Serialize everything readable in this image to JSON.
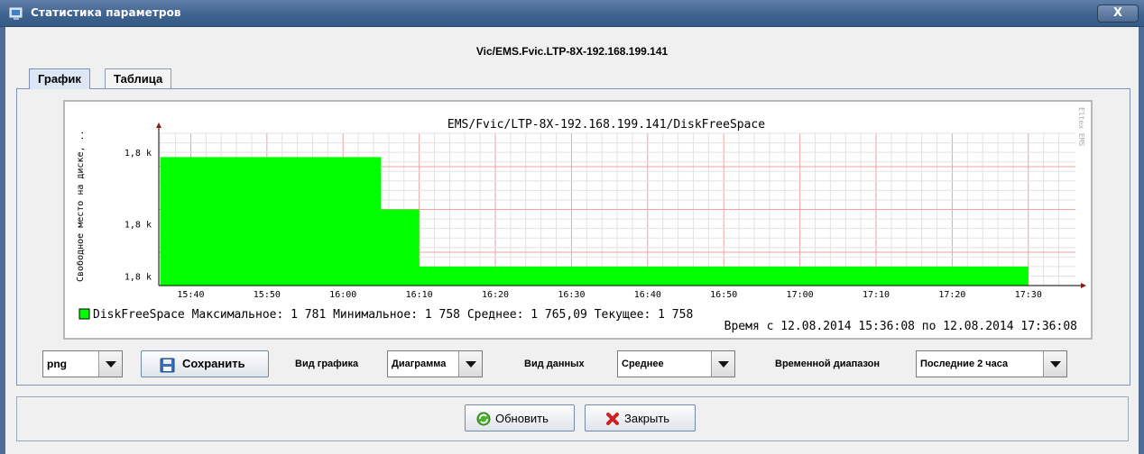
{
  "window": {
    "title": "Статистика параметров",
    "close_label": "X"
  },
  "device_name": "Vic/EMS.Fvic.LTP-8X-192.168.199.141",
  "tabs": [
    {
      "label": "График",
      "active": true
    },
    {
      "label": "Таблица",
      "active": false
    }
  ],
  "chart_data": {
    "type": "area",
    "title": "EMS/Fvic/LTP-8X-192.168.199.141/DiskFreeSpace",
    "ylabel": "Свободное место на диске, ..",
    "watermark": "Eltex EMS",
    "x_ticks": [
      "15:40",
      "15:50",
      "16:00",
      "16:10",
      "16:20",
      "16:30",
      "16:40",
      "16:50",
      "17:00",
      "17:10",
      "17:20",
      "17:30"
    ],
    "y_ticks": [
      "1,8 k",
      "1,8 k",
      "1,8 k"
    ],
    "series": [
      {
        "name": "DiskFreeSpace",
        "color": "#00ff00",
        "points": [
          {
            "x": "15:36",
            "y": 1781
          },
          {
            "x": "16:05",
            "y": 1781
          },
          {
            "x": "16:05",
            "y": 1770
          },
          {
            "x": "16:10",
            "y": 1770
          },
          {
            "x": "16:10",
            "y": 1758
          },
          {
            "x": "17:30",
            "y": 1758
          }
        ]
      }
    ],
    "legend": {
      "name": "DiskFreeSpace",
      "max": "Максимальное: 1 781",
      "min": "Минимальное: 1 758",
      "avg": "Среднее: 1 765,09",
      "cur": "Текущее: 1 758"
    },
    "time_range_text": "Время с 12.08.2014 15:36:08 по 12.08.2014 17:36:08"
  },
  "controls": {
    "format_value": "png",
    "save_label": "Сохранить",
    "chart_type_label": "Вид графика",
    "chart_type_value": "Диаграмма",
    "data_type_label": "Вид данных",
    "data_type_value": "Среднее",
    "range_label": "Временной диапазон",
    "range_value": "Последние 2 часа"
  },
  "buttons": {
    "refresh_label": "Обновить",
    "close_label": "Закрыть"
  }
}
